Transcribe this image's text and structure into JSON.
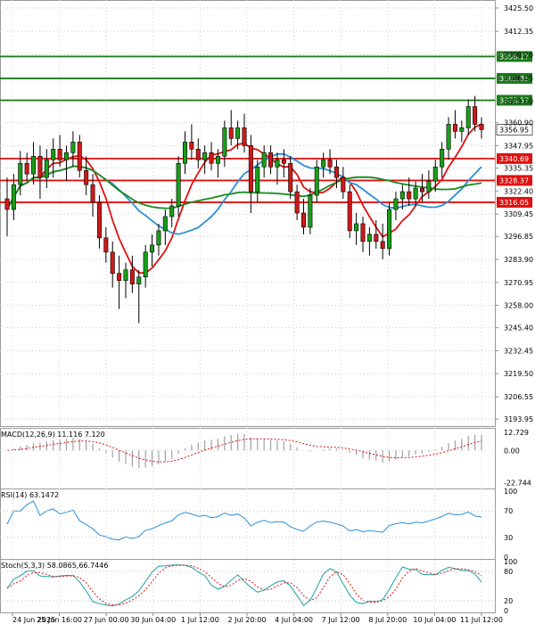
{
  "chart_data": {
    "type": "candlestick",
    "price_axis": {
      "range": [
        3190,
        3430
      ],
      "ticks": [
        "3425.50",
        "3412.35",
        "3399.20",
        "3386.05",
        "3373.00",
        "3360.90",
        "3347.95",
        "3335.35",
        "3322.40",
        "3309.45",
        "3296.85",
        "3283.90",
        "3270.95",
        "3258.00",
        "3245.40",
        "3232.45",
        "3219.50",
        "3206.55",
        "3193.95"
      ]
    },
    "levels": [
      {
        "value": 3398.17,
        "label": "3398.17",
        "color": "#1a7a1a"
      },
      {
        "value": 3385.85,
        "label": "3385.85",
        "color": "#1a7a1a"
      },
      {
        "value": 3373.53,
        "label": "3373.53",
        "color": "#1a7a1a"
      },
      {
        "value": 3340.69,
        "label": "3340.69",
        "color": "#e01010"
      },
      {
        "value": 3328.37,
        "label": "3328.37",
        "color": "#e01010"
      },
      {
        "value": 3316.05,
        "label": "3316.05",
        "color": "#e01010"
      }
    ],
    "current_price": {
      "value": 3356.95,
      "label": "3356.95"
    },
    "candles": [
      [
        3318,
        3330,
        3297,
        3312
      ],
      [
        3312,
        3332,
        3306,
        3326
      ],
      [
        3326,
        3345,
        3320,
        3338
      ],
      [
        3338,
        3344,
        3328,
        3332
      ],
      [
        3332,
        3350,
        3326,
        3342
      ],
      [
        3342,
        3348,
        3318,
        3330
      ],
      [
        3330,
        3346,
        3324,
        3340
      ],
      [
        3340,
        3352,
        3330,
        3346
      ],
      [
        3346,
        3354,
        3336,
        3340
      ],
      [
        3340,
        3348,
        3328,
        3344
      ],
      [
        3344,
        3356,
        3336,
        3350
      ],
      [
        3350,
        3354,
        3330,
        3334
      ],
      [
        3334,
        3342,
        3320,
        3326
      ],
      [
        3326,
        3332,
        3308,
        3316
      ],
      [
        3316,
        3320,
        3290,
        3296
      ],
      [
        3296,
        3302,
        3282,
        3288
      ],
      [
        3288,
        3294,
        3268,
        3276
      ],
      [
        3276,
        3286,
        3256,
        3272
      ],
      [
        3272,
        3282,
        3262,
        3278
      ],
      [
        3278,
        3286,
        3265,
        3270
      ],
      [
        3270,
        3278,
        3248,
        3274
      ],
      [
        3274,
        3292,
        3268,
        3288
      ],
      [
        3288,
        3298,
        3280,
        3292
      ],
      [
        3292,
        3304,
        3286,
        3300
      ],
      [
        3300,
        3312,
        3292,
        3308
      ],
      [
        3308,
        3318,
        3302,
        3314
      ],
      [
        3314,
        3342,
        3308,
        3338
      ],
      [
        3338,
        3356,
        3332,
        3350
      ],
      [
        3350,
        3360,
        3340,
        3346
      ],
      [
        3346,
        3352,
        3335,
        3340
      ],
      [
        3340,
        3348,
        3332,
        3344
      ],
      [
        3344,
        3350,
        3334,
        3338
      ],
      [
        3338,
        3346,
        3330,
        3342
      ],
      [
        3342,
        3362,
        3336,
        3358
      ],
      [
        3358,
        3368,
        3348,
        3352
      ],
      [
        3352,
        3362,
        3346,
        3358
      ],
      [
        3358,
        3366,
        3344,
        3348
      ],
      [
        3348,
        3354,
        3310,
        3322
      ],
      [
        3322,
        3340,
        3316,
        3336
      ],
      [
        3336,
        3348,
        3330,
        3344
      ],
      [
        3344,
        3348,
        3332,
        3336
      ],
      [
        3336,
        3344,
        3326,
        3340
      ],
      [
        3340,
        3346,
        3330,
        3338
      ],
      [
        3338,
        3342,
        3318,
        3322
      ],
      [
        3322,
        3326,
        3306,
        3310
      ],
      [
        3310,
        3318,
        3298,
        3302
      ],
      [
        3302,
        3324,
        3298,
        3320
      ],
      [
        3320,
        3340,
        3316,
        3336
      ],
      [
        3336,
        3344,
        3330,
        3340
      ],
      [
        3340,
        3346,
        3332,
        3336
      ],
      [
        3336,
        3340,
        3324,
        3330
      ],
      [
        3330,
        3336,
        3318,
        3322
      ],
      [
        3322,
        3326,
        3296,
        3300
      ],
      [
        3300,
        3310,
        3292,
        3304
      ],
      [
        3304,
        3308,
        3288,
        3294
      ],
      [
        3294,
        3302,
        3286,
        3298
      ],
      [
        3298,
        3306,
        3290,
        3294
      ],
      [
        3294,
        3304,
        3284,
        3290
      ],
      [
        3290,
        3316,
        3286,
        3312
      ],
      [
        3312,
        3322,
        3306,
        3318
      ],
      [
        3318,
        3326,
        3312,
        3322
      ],
      [
        3322,
        3330,
        3314,
        3318
      ],
      [
        3318,
        3328,
        3314,
        3324
      ],
      [
        3324,
        3332,
        3316,
        3322
      ],
      [
        3322,
        3334,
        3318,
        3328
      ],
      [
        3328,
        3340,
        3322,
        3336
      ],
      [
        3336,
        3350,
        3330,
        3346
      ],
      [
        3346,
        3364,
        3340,
        3360
      ],
      [
        3360,
        3368,
        3352,
        3356
      ],
      [
        3356,
        3362,
        3350,
        3358
      ],
      [
        3358,
        3374,
        3354,
        3370
      ],
      [
        3370,
        3376,
        3356,
        3360
      ],
      [
        3360,
        3364,
        3352,
        3357
      ]
    ],
    "macd": {
      "label": "MACD(12,26,9) 11.116 7.120",
      "ticks": [
        "12.729",
        "0.00",
        "-22.744"
      ],
      "range": [
        -25,
        14
      ]
    },
    "rsi": {
      "label": "RSI(14) 63.1472",
      "ticks": [
        "100",
        "70",
        "30",
        "0"
      ],
      "range": [
        0,
        100
      ]
    },
    "stoch": {
      "label": "Stoch(5,3,3) 58.0865,66.7446",
      "ticks": [
        "100",
        "80",
        "20",
        "0"
      ],
      "range": [
        0,
        100
      ]
    },
    "x_ticks": [
      "24 Jun 2025",
      "25 Jun 16:00",
      "27 Jun 00:00",
      "30 Jun 04:00",
      "1 Jul 12:00",
      "2 Jul 20:00",
      "4 Jul 04:00",
      "7 Jul 12:00",
      "8 Jul 20:00",
      "10 Jul 04:00",
      "11 Jul 12:00"
    ]
  }
}
